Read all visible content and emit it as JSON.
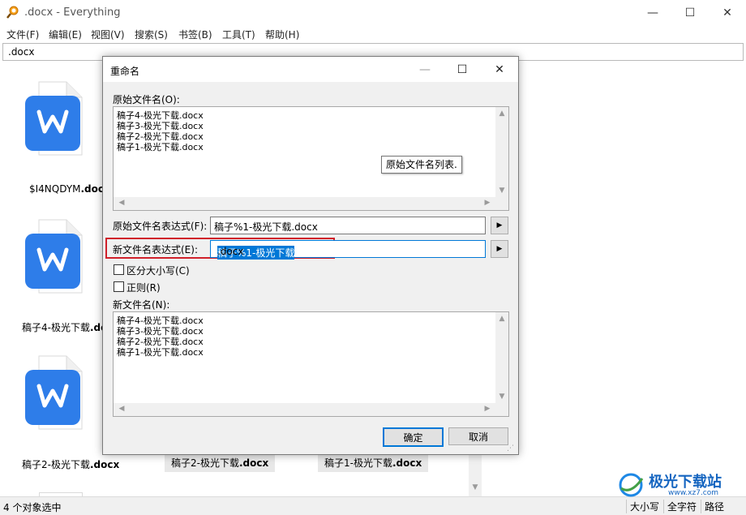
{
  "window": {
    "title": ".docx - Everything",
    "minimize": "—",
    "maximize": "☐",
    "close": "✕"
  },
  "menu": [
    "文件(F)",
    "编辑(E)",
    "视图(V)",
    "搜索(S)",
    "书签(B)",
    "工具(T)",
    "帮助(H)"
  ],
  "search": {
    "value": ".docx"
  },
  "files": {
    "tile1": {
      "name_prefix": "$I4NQDYM",
      "name_ext": ".docx"
    },
    "tile2": {
      "name_prefix": "稿子4-极光下载",
      "name_ext": ".do"
    },
    "tile3": {
      "name_prefix": "稿子2-极光下载",
      "name_ext": ".docx"
    },
    "sel1": {
      "name_prefix": "稿子2-极光下载",
      "name_ext": ".docx"
    },
    "sel2": {
      "name_prefix": "稿子1-极光下载",
      "name_ext": ".docx"
    }
  },
  "status": {
    "left": "4 个对象选中",
    "cells": [
      "大小写",
      "全字符",
      "路径"
    ]
  },
  "dialog": {
    "title": "重命名",
    "minimize": "—",
    "maximize": "☐",
    "close": "✕",
    "orig_names_label": "原始文件名(O):",
    "orig_names": [
      "稿子4-极光下载.docx",
      "稿子3-极光下载.docx",
      "稿子2-极光下载.docx",
      "稿子1-极光下载.docx"
    ],
    "tooltip": "原始文件名列表.",
    "orig_expr_label": "原始文件名表达式(F):",
    "orig_expr_value": "稿子%1-极光下载.docx",
    "new_expr_label": "新文件名表达式(E):",
    "new_expr_selected": "稿子%1-极光下载",
    "new_expr_rest": ".docx",
    "case_label": "区分大小写(C)",
    "regex_label": "正则(R)",
    "new_names_label": "新文件名(N):",
    "new_names": [
      "稿子4-极光下载.docx",
      "稿子3-极光下载.docx",
      "稿子2-极光下载.docx",
      "稿子1-极光下载.docx"
    ],
    "ok": "确定",
    "cancel": "取消",
    "arrow": "▶"
  },
  "watermark": {
    "text": "极光下载站",
    "url": "www.xz7.com"
  },
  "colors": {
    "accent": "#0078d7",
    "highlight": "#d0202a",
    "wps_blue": "#2e7de9"
  }
}
